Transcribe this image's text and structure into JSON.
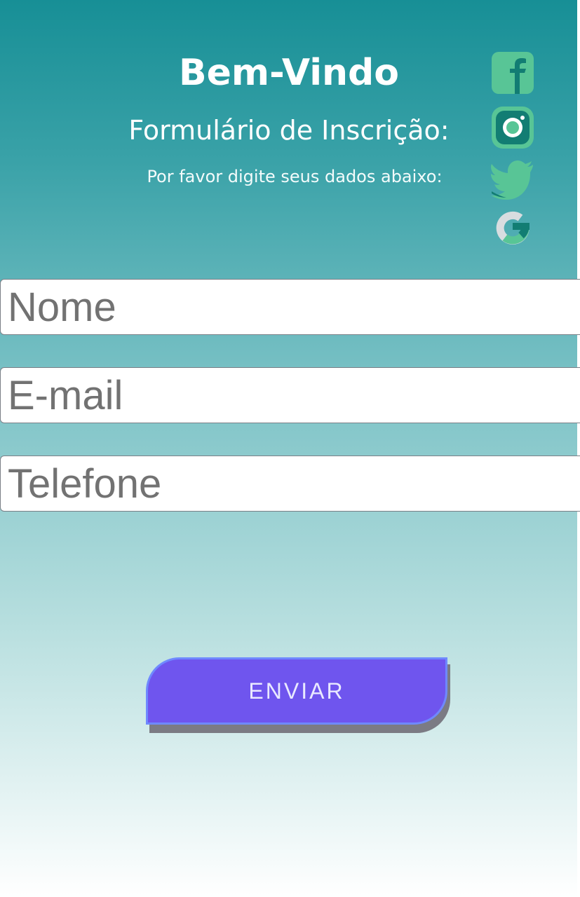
{
  "header": {
    "title": "Bem-Vindo",
    "subtitle": "Formulário de Inscrição:",
    "description": "Por favor digite seus dados abaixo:"
  },
  "social": [
    {
      "icon": "facebook-icon",
      "color": "#58c596"
    },
    {
      "icon": "instagram-icon",
      "color": "#58c596"
    },
    {
      "icon": "twitter-icon",
      "color": "#58c596"
    },
    {
      "icon": "google-icon",
      "color": "#58c596"
    }
  ],
  "form": {
    "name_placeholder": "Nome",
    "email_placeholder": "E-mail",
    "phone_placeholder": "Telefone",
    "submit_label": "ENVIAR"
  },
  "colors": {
    "background_top": "#178f96",
    "background_bottom": "#ffffff",
    "button": "#6f55ee",
    "button_border": "#6f89ff",
    "icon_light": "#58c596",
    "icon_dark": "#127d73"
  }
}
